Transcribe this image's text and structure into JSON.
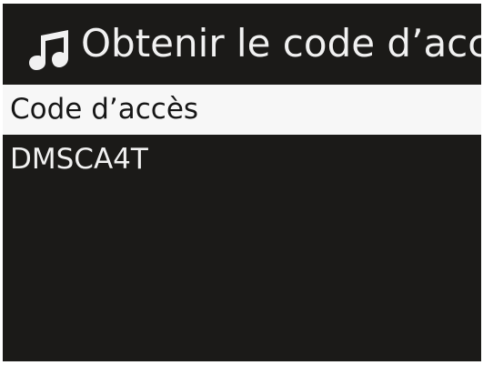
{
  "header": {
    "icon": "music-note-icon",
    "title": "Obtenir le code d’accè"
  },
  "list": {
    "items": [
      {
        "label": "Code d’accès",
        "selected": true
      },
      {
        "label": "DMSCA4T",
        "selected": false
      }
    ]
  },
  "colors": {
    "background": "#1b1a18",
    "selected_row": "#f7f7f7",
    "text_light": "#f1f1f1",
    "text_dark": "#161616"
  }
}
